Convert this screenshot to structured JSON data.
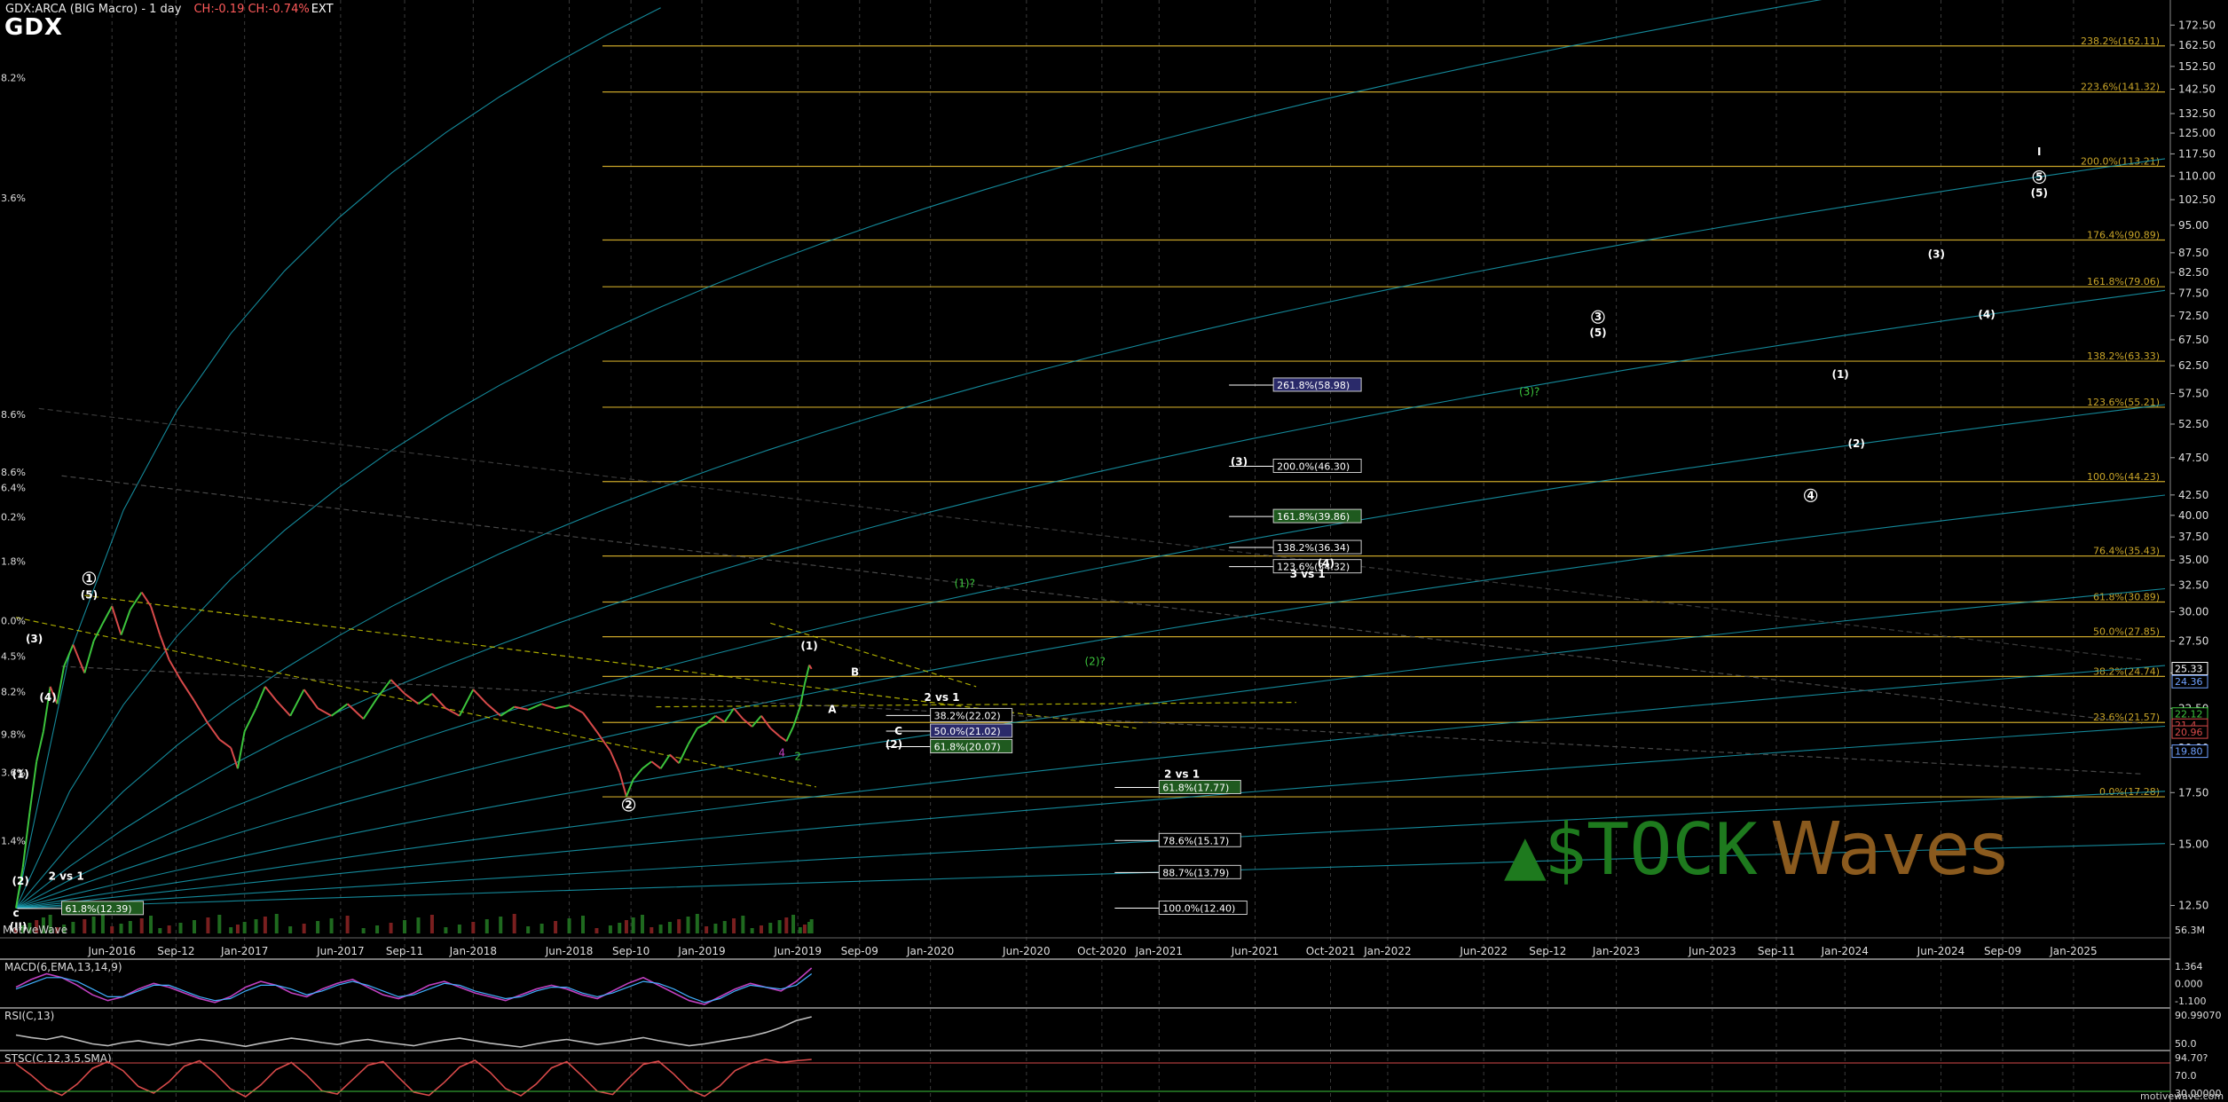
{
  "header": {
    "title": "GDX:ARCA (BIG Macro) - 1 day",
    "change": "CH:-0.19 CH:-0.74%",
    "ext": "EXT",
    "symbol": "GDX"
  },
  "footer": {
    "left": "MotiveWave",
    "right": "motivewave.com"
  },
  "colors": {
    "background": "#000000",
    "fib": "#c8a428",
    "gann": "#18a0b4",
    "price_up": "#3cc43c",
    "price_down": "#d84a4a",
    "trend": "#c8c800",
    "label": "#ffffff",
    "alt_label": "#3cc43c",
    "macd": "#c040c0",
    "signal": "#40b0ff",
    "watermark": "#1e7a1e",
    "watermark_v": "#8a5a1e"
  },
  "chart_data": [
    {
      "type": "line",
      "title": "GDX:ARCA (BIG Macro) - 1 day",
      "scale": "log",
      "ylim": [
        11.5,
        182
      ],
      "xlim": [
        2016.0,
        2025.4
      ],
      "y_ticks": [
        "172.50",
        "162.50",
        "152.50",
        "142.50",
        "132.50",
        "125.00",
        "117.50",
        "110.00",
        "102.50",
        "95.00",
        "87.50",
        "82.50",
        "77.50",
        "72.50",
        "67.50",
        "62.50",
        "57.50",
        "52.50",
        "47.50",
        "42.50",
        "40.00",
        "37.50",
        "35.00",
        "32.50",
        "30.00",
        "27.50",
        "25.00",
        "22.50",
        "20.00",
        "17.50",
        "15.00",
        "12.50"
      ],
      "x_ticks": [
        {
          "x": 2016.42,
          "label": "Jun-2016"
        },
        {
          "x": 2016.7,
          "label": "Sep-12"
        },
        {
          "x": 2017.0,
          "label": "Jan-2017"
        },
        {
          "x": 2017.42,
          "label": "Jun-2017"
        },
        {
          "x": 2017.7,
          "label": "Sep-11"
        },
        {
          "x": 2018.0,
          "label": "Jan-2018"
        },
        {
          "x": 2018.42,
          "label": "Jun-2018"
        },
        {
          "x": 2018.69,
          "label": "Sep-10"
        },
        {
          "x": 2019.0,
          "label": "Jan-2019"
        },
        {
          "x": 2019.42,
          "label": "Jun-2019"
        },
        {
          "x": 2019.69,
          "label": "Sep-09"
        },
        {
          "x": 2020.0,
          "label": "Jan-2020"
        },
        {
          "x": 2020.42,
          "label": "Jun-2020"
        },
        {
          "x": 2020.75,
          "label": "Oct-2020"
        },
        {
          "x": 2021.0,
          "label": "Jan-2021"
        },
        {
          "x": 2021.42,
          "label": "Jun-2021"
        },
        {
          "x": 2021.75,
          "label": "Oct-2021"
        },
        {
          "x": 2022.0,
          "label": "Jan-2022"
        },
        {
          "x": 2022.42,
          "label": "Jun-2022"
        },
        {
          "x": 2022.7,
          "label": "Sep-12"
        },
        {
          "x": 2023.0,
          "label": "Jan-2023"
        },
        {
          "x": 2023.42,
          "label": "Jun-2023"
        },
        {
          "x": 2023.7,
          "label": "Sep-11"
        },
        {
          "x": 2024.0,
          "label": "Jan-2024"
        },
        {
          "x": 2024.42,
          "label": "Jun-2024"
        },
        {
          "x": 2024.69,
          "label": "Sep-09"
        },
        {
          "x": 2025.0,
          "label": "Jan-2025"
        }
      ],
      "price_tags": [
        {
          "y": 25.33,
          "label": "25.33",
          "color": "#ffffff"
        },
        {
          "y": 24.36,
          "label": "24.36",
          "color": "#6fa0ff"
        },
        {
          "y": 22.12,
          "label": "22.12",
          "color": "#3cc43c"
        },
        {
          "y": 21.4,
          "label": "21.4",
          "color": "#d84a4a"
        },
        {
          "y": 20.96,
          "label": "20.96",
          "color": "#d84a4a"
        },
        {
          "y": 19.8,
          "label": "19.80",
          "color": "#6fa0ff"
        }
      ],
      "volume_label": "56.3M",
      "price_series": [
        [
          2016.0,
          12.4
        ],
        [
          2016.03,
          14.0
        ],
        [
          2016.06,
          16.5
        ],
        [
          2016.09,
          19.2
        ],
        [
          2016.12,
          21.0
        ],
        [
          2016.15,
          24.0
        ],
        [
          2016.18,
          22.8
        ],
        [
          2016.21,
          25.5
        ],
        [
          2016.25,
          27.2
        ],
        [
          2016.3,
          25.0
        ],
        [
          2016.34,
          27.5
        ],
        [
          2016.38,
          29.0
        ],
        [
          2016.42,
          30.5
        ],
        [
          2016.46,
          28.0
        ],
        [
          2016.5,
          30.2
        ],
        [
          2016.55,
          31.8
        ],
        [
          2016.59,
          30.5
        ],
        [
          2016.63,
          28.0
        ],
        [
          2016.67,
          26.0
        ],
        [
          2016.72,
          24.5
        ],
        [
          2016.78,
          23.0
        ],
        [
          2016.84,
          21.5
        ],
        [
          2016.89,
          20.5
        ],
        [
          2016.94,
          20.0
        ],
        [
          2016.97,
          18.8
        ],
        [
          2017.0,
          21.0
        ],
        [
          2017.05,
          22.5
        ],
        [
          2017.09,
          24.0
        ],
        [
          2017.14,
          23.0
        ],
        [
          2017.2,
          22.0
        ],
        [
          2017.26,
          23.8
        ],
        [
          2017.32,
          22.5
        ],
        [
          2017.38,
          22.0
        ],
        [
          2017.45,
          22.8
        ],
        [
          2017.52,
          21.8
        ],
        [
          2017.58,
          23.2
        ],
        [
          2017.64,
          24.5
        ],
        [
          2017.7,
          23.5
        ],
        [
          2017.76,
          22.8
        ],
        [
          2017.82,
          23.5
        ],
        [
          2017.88,
          22.5
        ],
        [
          2017.94,
          22.0
        ],
        [
          2018.0,
          23.8
        ],
        [
          2018.06,
          22.8
        ],
        [
          2018.12,
          22.0
        ],
        [
          2018.18,
          22.6
        ],
        [
          2018.24,
          22.4
        ],
        [
          2018.3,
          22.8
        ],
        [
          2018.36,
          22.5
        ],
        [
          2018.42,
          22.7
        ],
        [
          2018.48,
          22.2
        ],
        [
          2018.54,
          21.0
        ],
        [
          2018.6,
          19.8
        ],
        [
          2018.64,
          18.6
        ],
        [
          2018.67,
          17.3
        ],
        [
          2018.7,
          18.2
        ],
        [
          2018.74,
          18.8
        ],
        [
          2018.78,
          19.2
        ],
        [
          2018.82,
          18.8
        ],
        [
          2018.86,
          19.6
        ],
        [
          2018.9,
          19.1
        ],
        [
          2018.94,
          20.2
        ],
        [
          2018.98,
          21.2
        ],
        [
          2019.02,
          21.5
        ],
        [
          2019.06,
          22.0
        ],
        [
          2019.1,
          21.6
        ],
        [
          2019.14,
          22.5
        ],
        [
          2019.18,
          21.8
        ],
        [
          2019.22,
          21.3
        ],
        [
          2019.26,
          22.0
        ],
        [
          2019.3,
          21.2
        ],
        [
          2019.34,
          20.7
        ],
        [
          2019.37,
          20.4
        ],
        [
          2019.4,
          21.3
        ],
        [
          2019.43,
          22.6
        ],
        [
          2019.45,
          24.2
        ],
        [
          2019.47,
          25.6
        ],
        [
          2019.48,
          25.3
        ]
      ],
      "fib_levels": [
        {
          "y": 162.11,
          "label": "238.2%(162.11)"
        },
        {
          "y": 141.32,
          "label": "223.6%(141.32)"
        },
        {
          "y": 113.21,
          "label": "200.0%(113.21)"
        },
        {
          "y": 90.89,
          "label": "176.4%(90.89)"
        },
        {
          "y": 79.06,
          "label": "161.8%(79.06)"
        },
        {
          "y": 63.33,
          "label": "138.2%(63.33)"
        },
        {
          "y": 55.21,
          "label": "123.6%(55.21)"
        },
        {
          "y": 44.23,
          "label": "100.0%(44.23)"
        },
        {
          "y": 35.43,
          "label": "76.4%(35.43)"
        },
        {
          "y": 30.89,
          "label": "61.8%(30.89)"
        },
        {
          "y": 27.85,
          "label": "50.0%(27.85)"
        },
        {
          "y": 24.74,
          "label": "38.2%(24.74)"
        },
        {
          "y": 21.57,
          "label": "23.6%(21.57)"
        },
        {
          "y": 17.28,
          "label": "0.0%(17.28)"
        }
      ],
      "boxed_levels": [
        {
          "x": 2021.5,
          "y": 58.98,
          "label": "261.8%(58.98)",
          "fill": "#2a2a6a",
          "color": "#ffffff"
        },
        {
          "x": 2021.5,
          "y": 46.3,
          "label": "200.0%(46.30)",
          "fill": "#000000",
          "color": "#ffffff"
        },
        {
          "x": 2021.5,
          "y": 39.86,
          "label": "161.8%(39.86)",
          "fill": "#1f5a1f",
          "color": "#ffffff"
        },
        {
          "x": 2021.5,
          "y": 36.34,
          "label": "138.2%(36.34)",
          "fill": "#000000",
          "color": "#ffffff"
        },
        {
          "x": 2021.5,
          "y": 34.32,
          "label": "123.6%(34.32)",
          "fill": "#000000",
          "color": "#ffffff"
        },
        {
          "x": 2020.0,
          "y": 22.02,
          "label": "38.2%(22.02)",
          "fill": "#000000",
          "color": "#ffffff"
        },
        {
          "x": 2020.0,
          "y": 21.02,
          "label": "50.0%(21.02)",
          "fill": "#2a2a6a",
          "color": "#ffffff"
        },
        {
          "x": 2020.0,
          "y": 20.07,
          "label": "61.8%(20.07)",
          "fill": "#1f5a1f",
          "color": "#ffffff"
        },
        {
          "x": 2021.0,
          "y": 17.77,
          "label": "61.8%(17.77)",
          "fill": "#1f5a1f",
          "color": "#ffffff"
        },
        {
          "x": 2021.0,
          "y": 15.17,
          "label": "78.6%(15.17)",
          "fill": "#000000",
          "color": "#ffffff"
        },
        {
          "x": 2021.0,
          "y": 13.79,
          "label": "88.7%(13.79)",
          "fill": "#000000",
          "color": "#ffffff"
        },
        {
          "x": 2021.0,
          "y": 12.4,
          "label": "100.0%(12.40)",
          "fill": "#000000",
          "color": "#ffffff"
        },
        {
          "x": 2016.2,
          "y": 12.39,
          "label": "61.8%(12.39)",
          "fill": "#1f5a1f",
          "color": "#ffffff"
        }
      ],
      "wave_labels": [
        {
          "x": 2016.32,
          "y": 32.8,
          "label": "1",
          "circle": true
        },
        {
          "x": 2016.32,
          "y": 31.2,
          "label": "(5)"
        },
        {
          "x": 2016.08,
          "y": 27.4,
          "label": "(3)"
        },
        {
          "x": 2016.14,
          "y": 23.0,
          "label": "(4)"
        },
        {
          "x": 2016.02,
          "y": 18.3,
          "label": "(1)"
        },
        {
          "x": 2016.02,
          "y": 13.3,
          "label": "(2)"
        },
        {
          "x": 2016.0,
          "y": 12.1,
          "label": "c"
        },
        {
          "x": 2016.01,
          "y": 11.6,
          "label": "(II)"
        },
        {
          "x": 2016.22,
          "y": 13.5,
          "label": "2 vs 1"
        },
        {
          "x": 2018.68,
          "y": 16.7,
          "label": "2",
          "circle": true
        },
        {
          "x": 2019.47,
          "y": 26.8,
          "label": "(1)"
        },
        {
          "x": 2019.67,
          "y": 24.8,
          "label": "B"
        },
        {
          "x": 2019.57,
          "y": 22.2,
          "label": "A"
        },
        {
          "x": 2019.86,
          "y": 20.8,
          "label": "C"
        },
        {
          "x": 2019.84,
          "y": 20.0,
          "label": "(2)"
        },
        {
          "x": 2020.05,
          "y": 23.0,
          "label": "2 vs 1"
        },
        {
          "x": 2021.1,
          "y": 18.3,
          "label": "2 vs 1"
        },
        {
          "x": 2021.35,
          "y": 46.4,
          "label": "(3)"
        },
        {
          "x": 2021.73,
          "y": 34.3,
          "label": "(4)"
        },
        {
          "x": 2021.65,
          "y": 33.2,
          "label": "3 vs 1"
        },
        {
          "x": 2022.92,
          "y": 71.5,
          "label": "3",
          "circle": true
        },
        {
          "x": 2022.92,
          "y": 68.2,
          "label": "(5)"
        },
        {
          "x": 2023.85,
          "y": 42.0,
          "label": "4",
          "circle": true
        },
        {
          "x": 2023.98,
          "y": 60.2,
          "label": "(1)"
        },
        {
          "x": 2024.05,
          "y": 49.0,
          "label": "(2)"
        },
        {
          "x": 2024.4,
          "y": 86.2,
          "label": "(3)"
        },
        {
          "x": 2024.62,
          "y": 72.0,
          "label": "(4)"
        },
        {
          "x": 2024.85,
          "y": 108.5,
          "label": "5",
          "circle": true
        },
        {
          "x": 2024.85,
          "y": 103.5,
          "label": "(5)"
        },
        {
          "x": 2024.85,
          "y": 117.0,
          "label": "I"
        }
      ],
      "alt_labels": [
        {
          "x": 2020.15,
          "y": 32.3,
          "label": "(1)?"
        },
        {
          "x": 2020.72,
          "y": 25.6,
          "label": "(2)?"
        },
        {
          "x": 2022.62,
          "y": 57.2,
          "label": "(3)?"
        },
        {
          "x": 2019.42,
          "y": 19.3,
          "label": "2"
        },
        {
          "x": 2019.35,
          "y": 19.5,
          "label": "4",
          "color": "#c040c0"
        }
      ],
      "left_axis_pct": [
        {
          "y": 146.0,
          "label": "8.2%"
        },
        {
          "y": 102.0,
          "label": "3.6%"
        },
        {
          "y": 53.5,
          "label": "8.6%"
        },
        {
          "y": 45.0,
          "label": "8.6%"
        },
        {
          "y": 43.0,
          "label": "6.4%"
        },
        {
          "y": 39.4,
          "label": "0.2%"
        },
        {
          "y": 34.5,
          "label": "1.8%"
        },
        {
          "y": 28.9,
          "label": "0.0%"
        },
        {
          "y": 26.0,
          "label": "4.5%"
        },
        {
          "y": 23.4,
          "label": "8.2%"
        },
        {
          "y": 20.6,
          "label": "9.8%"
        },
        {
          "y": 18.4,
          "label": "3.6%"
        },
        {
          "y": 15.0,
          "label": "1.4%"
        }
      ],
      "gann_fan": {
        "origin": [
          2016.0,
          12.4
        ],
        "slopes_per_year": [
          60,
          22,
          11,
          7,
          4.6,
          3.2,
          2.1,
          1.4,
          0.95,
          0.55,
          0.28
        ]
      }
    },
    {
      "type": "line",
      "title": "MACD(6,EMA,13,14,9)",
      "value_labels": [
        "1.364",
        "0.000",
        "-1.100"
      ],
      "values": [
        0.2,
        0.6,
        0.9,
        0.7,
        0.3,
        -0.2,
        -0.5,
        -0.3,
        0.1,
        0.4,
        0.2,
        -0.1,
        -0.4,
        -0.6,
        -0.3,
        0.2,
        0.5,
        0.3,
        -0.1,
        -0.3,
        0.1,
        0.4,
        0.6,
        0.2,
        -0.2,
        -0.4,
        -0.1,
        0.3,
        0.5,
        0.2,
        -0.1,
        -0.3,
        -0.5,
        -0.2,
        0.1,
        0.3,
        0.1,
        -0.2,
        -0.4,
        0.0,
        0.4,
        0.7,
        0.3,
        -0.1,
        -0.5,
        -0.7,
        -0.3,
        0.1,
        0.4,
        0.2,
        0.0,
        0.5,
        1.2
      ],
      "signal": [
        0.1,
        0.4,
        0.7,
        0.7,
        0.5,
        0.1,
        -0.3,
        -0.3,
        0.0,
        0.3,
        0.3,
        0.0,
        -0.3,
        -0.5,
        -0.4,
        0.0,
        0.3,
        0.3,
        0.1,
        -0.2,
        0.0,
        0.3,
        0.5,
        0.3,
        0.0,
        -0.3,
        -0.2,
        0.1,
        0.4,
        0.3,
        0.0,
        -0.2,
        -0.4,
        -0.3,
        0.0,
        0.2,
        0.2,
        -0.1,
        -0.3,
        -0.1,
        0.2,
        0.5,
        0.4,
        0.1,
        -0.3,
        -0.6,
        -0.4,
        0.0,
        0.3,
        0.2,
        0.1,
        0.3,
        0.9
      ]
    },
    {
      "type": "line",
      "title": "RSI(C,13)",
      "value_labels": [
        "90.99070",
        "50.0"
      ],
      "values": [
        62,
        58,
        55,
        60,
        54,
        48,
        45,
        50,
        53,
        49,
        46,
        51,
        55,
        52,
        48,
        44,
        49,
        53,
        57,
        54,
        50,
        47,
        52,
        55,
        51,
        48,
        45,
        50,
        54,
        57,
        53,
        49,
        46,
        43,
        48,
        52,
        55,
        51,
        47,
        50,
        54,
        58,
        53,
        49,
        45,
        48,
        52,
        56,
        60,
        66,
        74,
        85,
        91
      ]
    },
    {
      "type": "line",
      "title": "STSC(C,12,3,5,SMA)",
      "value_labels": [
        "94.70?",
        "70.0",
        "30.00000"
      ],
      "values": [
        85,
        60,
        30,
        15,
        40,
        75,
        90,
        70,
        35,
        20,
        45,
        80,
        92,
        65,
        30,
        12,
        38,
        72,
        88,
        60,
        25,
        18,
        50,
        82,
        90,
        55,
        22,
        15,
        44,
        78,
        93,
        66,
        30,
        14,
        40,
        76,
        90,
        58,
        24,
        17,
        52,
        84,
        91,
        62,
        28,
        13,
        36,
        70,
        86,
        95,
        88,
        92,
        95
      ]
    }
  ],
  "watermark": {
    "left": "$TOCK",
    "right": "Waves"
  }
}
